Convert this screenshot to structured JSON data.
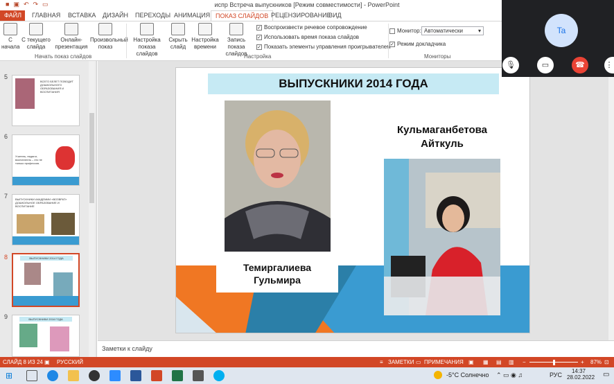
{
  "window": {
    "title": "испр Встреча выпускников [Режим совместимости] - PowerPoint"
  },
  "tabs": [
    "ФАЙЛ",
    "ГЛАВНАЯ",
    "ВСТАВКА",
    "ДИЗАЙН",
    "ПЕРЕХОДЫ",
    "АНИМАЦИЯ",
    "ПОКАЗ СЛАЙДОВ",
    "РЕЦЕНЗИРОВАНИЕ",
    "ВИД"
  ],
  "ribbon": {
    "start_group": {
      "from_start": "С начала",
      "from_current": "С текущего слайда",
      "online": "Онлайн-презентация",
      "custom": "Произвольный показ",
      "label": "Начать показ слайдов"
    },
    "setup_group": {
      "setup": "Настройка показа слайдов",
      "hide": "Скрыть слайд",
      "rehearse": "Настройка времени",
      "record": "Запись показа слайдов",
      "chk1": "Воспроизвести речевое сопровождение",
      "chk2": "Использовать время показа слайдов",
      "chk3": "Показать элементы управления проигрывателем",
      "label": "Настройка"
    },
    "monitors_group": {
      "monitor_label": "Монитор:",
      "monitor_value": "Автоматически",
      "presenter": "Режим докладчика",
      "label": "Мониторы"
    }
  },
  "thumbnails": [
    {
      "num": "5",
      "text": "ВСЕГО БЕЛЕТ ПОВОДИТ ДОШКОЛЬНОГО ОБРАЗОВАНИЯ И ВОСПИТАНИЯ"
    },
    {
      "num": "6",
      "text": "Учитель, педагог, воспитатель – это не только профессия."
    },
    {
      "num": "7",
      "text": "ВЫПУСКНИКИ АКАДЕМИИ «ВОЗВРАТ» ДОШКОЛЬНОЕ ОБРАЗОВАНИЕ И ВОСПИТАНИЕ"
    },
    {
      "num": "8",
      "text": "ВЫПУСКНИКИ 2014 ГОДА"
    },
    {
      "num": "9",
      "text": "ВЫПУСКНИКИ 2016 ГОДА"
    }
  ],
  "slide": {
    "title": "ВЫПУСКНИКИ 2014 ГОДА",
    "person1_line1": "Темиргалиева",
    "person1_line2": "Гульмира",
    "person2_line1": "Кульмаганбетова",
    "person2_line2": "Айткуль"
  },
  "notes_placeholder": "Заметки к слайду",
  "status": {
    "slide_info": "СЛАЙД 8 ИЗ 24",
    "language": "РУССКИЙ",
    "notes": "ЗАМЕТКИ",
    "comments": "ПРИМЕЧАНИЯ",
    "zoom": "87%"
  },
  "taskbar": {
    "weather": "-5°C  Солнечно",
    "lang": "РУС",
    "time": "14:37",
    "date": "28.02.2022"
  },
  "meet": {
    "avatar": "Ta"
  }
}
